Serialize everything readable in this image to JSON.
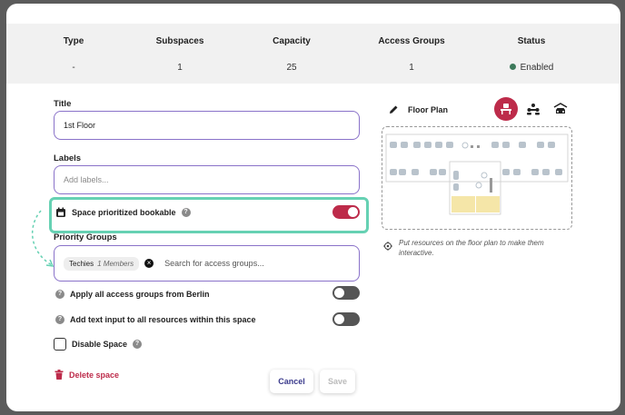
{
  "summary": {
    "columns": [
      {
        "header": "Type",
        "value": "-"
      },
      {
        "header": "Subspaces",
        "value": "1"
      },
      {
        "header": "Capacity",
        "value": "25"
      },
      {
        "header": "Access Groups",
        "value": "1"
      },
      {
        "header": "Status",
        "value": "Enabled"
      }
    ],
    "status_color": "#3d7a5b"
  },
  "form": {
    "title_label": "Title",
    "title_value": "1st Floor",
    "labels_label": "Labels",
    "labels_placeholder": "Add labels...",
    "prioritized_label": "Space prioritized bookable",
    "prioritized_on": true,
    "priority_groups_label": "Priority Groups",
    "chip_name": "Techies",
    "chip_members": "1 Members",
    "groups_placeholder": "Search for access groups...",
    "apply_groups_label": "Apply all access groups from Berlin",
    "apply_groups_on": false,
    "text_input_label": "Add text input to all resources within this space",
    "text_input_on": false,
    "disable_label": "Disable Space",
    "help_glyph": "?",
    "delete_label": "Delete space"
  },
  "actions": {
    "cancel": "Cancel",
    "save": "Save"
  },
  "floor_plan": {
    "title": "Floor Plan",
    "note": "Put resources on the floor plan to make them interactive.",
    "tools": [
      "desk-icon",
      "people-icon",
      "car-icon"
    ],
    "active_tool": "desk-icon"
  },
  "colors": {
    "accent": "#bd2b4a",
    "field_border": "#8a72c9",
    "highlight": "#66d1b3",
    "link": "#3a3a8c"
  }
}
